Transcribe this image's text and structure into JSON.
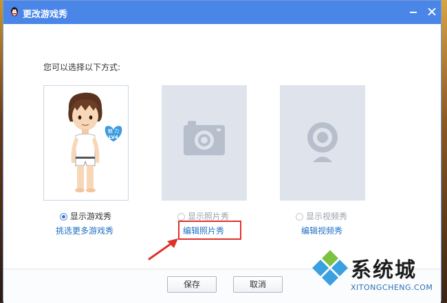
{
  "window": {
    "title": "更改游戏秀"
  },
  "prompt": "您可以选择以下方式:",
  "badge": {
    "top": "魅 力",
    "bottom": "LV4"
  },
  "options": [
    {
      "label": "显示游戏秀",
      "link": "挑选更多游戏秀",
      "selected": true,
      "enabled": true
    },
    {
      "label": "显示照片秀",
      "link": "编辑照片秀",
      "selected": false,
      "enabled": false
    },
    {
      "label": "显示视频秀",
      "link": "编辑视频秀",
      "selected": false,
      "enabled": false
    }
  ],
  "buttons": {
    "save": "保存",
    "cancel": "取消"
  },
  "watermark": {
    "title": "系统城",
    "url": "XITONGCHENG.COM"
  },
  "colors": {
    "titlebar": "#4a86e8",
    "link": "#1e6fc4",
    "highlight": "#e0302a",
    "placeholder": "#dfe3eb"
  }
}
